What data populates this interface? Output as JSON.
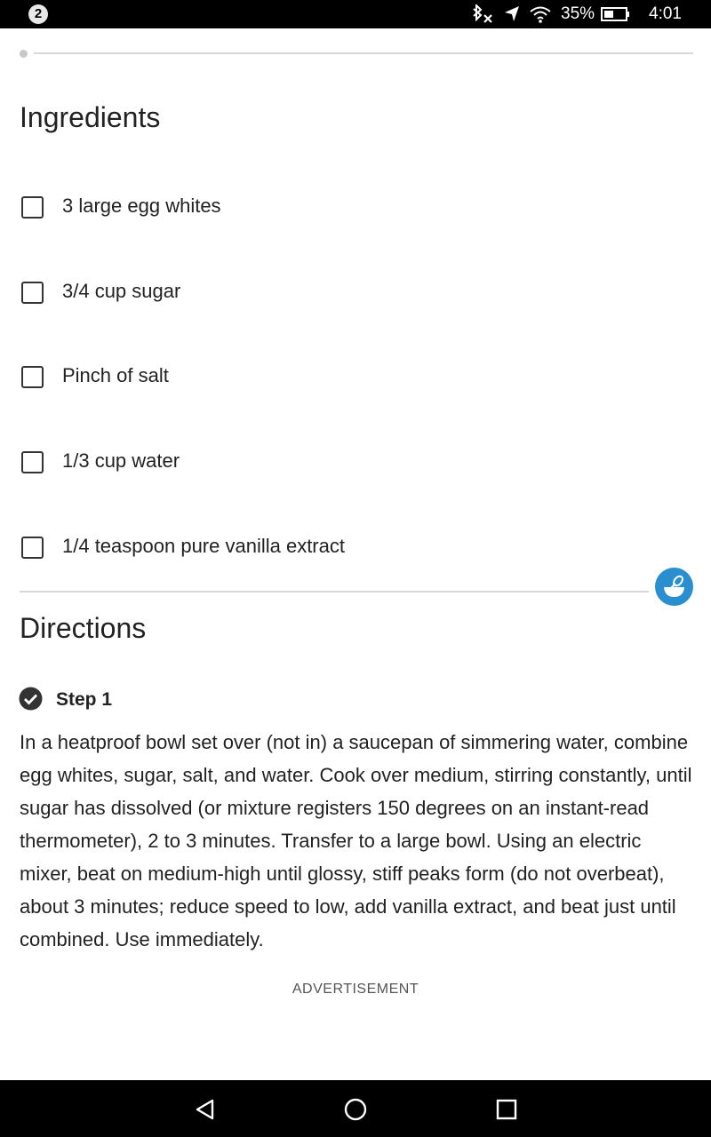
{
  "status_bar": {
    "notification_count": "2",
    "battery_percent": "35%",
    "time": "4:01",
    "icons": [
      "bluetooth-off-icon",
      "location-icon",
      "wifi-icon",
      "battery-icon"
    ]
  },
  "ingredients": {
    "title": "Ingredients",
    "items": [
      {
        "label": "3 large egg whites",
        "checked": false
      },
      {
        "label": "3/4 cup sugar",
        "checked": false
      },
      {
        "label": "Pinch of salt",
        "checked": false
      },
      {
        "label": "1/3 cup water",
        "checked": false
      },
      {
        "label": "1/4 teaspoon pure vanilla extract",
        "checked": false
      }
    ]
  },
  "mixer_button": {
    "icon": "mixing-bowl-icon",
    "color": "#2a8fcf"
  },
  "directions": {
    "title": "Directions",
    "steps": [
      {
        "label": "Step 1",
        "completed": true,
        "text": "In a heatproof bowl set over (not in) a saucepan of simmering water, combine egg whites, sugar, salt, and water. Cook over medium, stirring constantly, until sugar has dissolved (or mixture registers 150 degrees on an instant-read thermometer), 2 to 3 minutes. Transfer to a large bowl. Using an electric mixer, beat on medium-high until glossy, stiff peaks form (do not overbeat), about 3 minutes; reduce speed to low, add vanilla extract, and beat just until combined. Use immediately."
      }
    ]
  },
  "advertisement_label": "ADVERTISEMENT",
  "nav_bar": {
    "buttons": [
      "back-icon",
      "home-icon",
      "recents-icon"
    ]
  }
}
